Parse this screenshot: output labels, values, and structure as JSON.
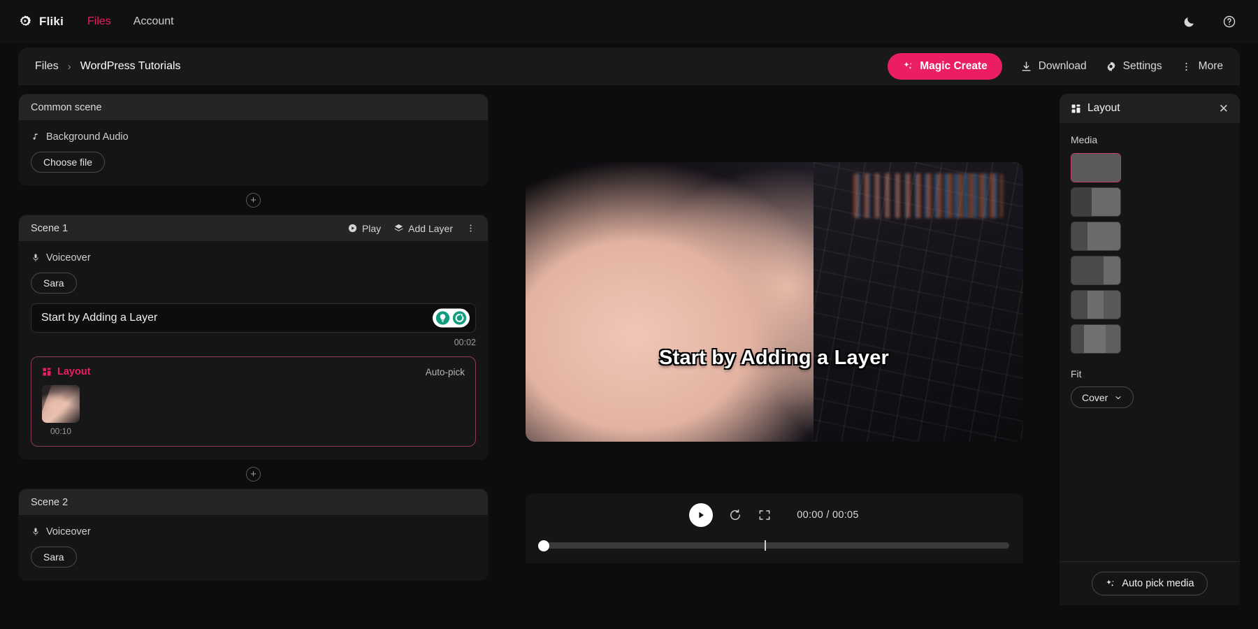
{
  "navbar": {
    "brand": "Fliki",
    "brand_icon": "gear-play-logo-icon",
    "links": [
      {
        "label": "Files",
        "active": true
      },
      {
        "label": "Account",
        "active": false
      }
    ],
    "theme_toggle_icon": "moon-icon",
    "help_icon": "help-circle-icon"
  },
  "toolbar": {
    "breadcrumb_root": "Files",
    "breadcrumb_separator": "›",
    "breadcrumb_current": "WordPress Tutorials",
    "magic_create_label": "Magic Create",
    "magic_create_icon": "sparkles-icon",
    "download_label": "Download",
    "download_icon": "download-icon",
    "settings_label": "Settings",
    "settings_icon": "gear-icon",
    "more_label": "More",
    "more_icon": "dots-vertical-icon",
    "accent_color": "#ec1e63"
  },
  "timeline": {
    "common_scene": {
      "title": "Common scene",
      "audio_label": "Background Audio",
      "audio_icon": "music-note-icon",
      "choose_file_label": "Choose file"
    },
    "add_scene_icon": "plus-circle-icon",
    "scene_1": {
      "title": "Scene 1",
      "play_label": "Play",
      "play_icon": "play-circle-icon",
      "add_layer_label": "Add Layer",
      "add_layer_icon": "layers-icon",
      "more_icon": "dots-vertical-icon",
      "voiceover_label": "Voiceover",
      "voiceover_icon": "microphone-icon",
      "voice_name": "Sara",
      "script_text": "Start by Adding a Layer",
      "script_duration": "00:02",
      "tool_idea_icon": "lightbulb-icon",
      "tool_regenerate_icon": "refresh-icon",
      "layout": {
        "title": "Layout",
        "icon": "layout-grid-icon",
        "auto_pick_label": "Auto-pick",
        "media_duration": "00:10"
      }
    },
    "scene_2": {
      "title": "Scene 2",
      "voiceover_label": "Voiceover",
      "voiceover_icon": "microphone-icon",
      "voice_name": "Sara"
    }
  },
  "preview": {
    "caption": "Start by Adding a Layer",
    "play_icon": "play-icon",
    "replay_icon": "replay-icon",
    "fullscreen_icon": "fullscreen-icon",
    "time_display": "00:00 / 00:05",
    "current_time": "00:00",
    "total_time": "00:05",
    "progress_percent": 0
  },
  "right_panel": {
    "title": "Layout",
    "title_icon": "layout-grid-icon",
    "close_icon": "close-icon",
    "media_label": "Media",
    "layout_options": [
      {
        "name": "single-full",
        "panes": [
          100
        ],
        "selected": true
      },
      {
        "name": "split-2-left-narrow",
        "panes": [
          42,
          58
        ],
        "selected": false
      },
      {
        "name": "split-2-left-narrower",
        "panes": [
          33,
          67
        ],
        "selected": false
      },
      {
        "name": "split-2-right-narrow",
        "panes": [
          66,
          34
        ],
        "selected": false
      },
      {
        "name": "split-3-uneven",
        "panes": [
          33,
          33,
          34
        ],
        "selected": false
      },
      {
        "name": "split-3-even",
        "panes": [
          25,
          45,
          30
        ],
        "selected": false
      }
    ],
    "fit_label": "Fit",
    "fit_value": "Cover",
    "fit_chevron_icon": "chevron-down-icon",
    "auto_pick_media_label": "Auto pick media",
    "auto_pick_media_icon": "sparkles-icon",
    "selected_border_color": "#c2406b"
  }
}
